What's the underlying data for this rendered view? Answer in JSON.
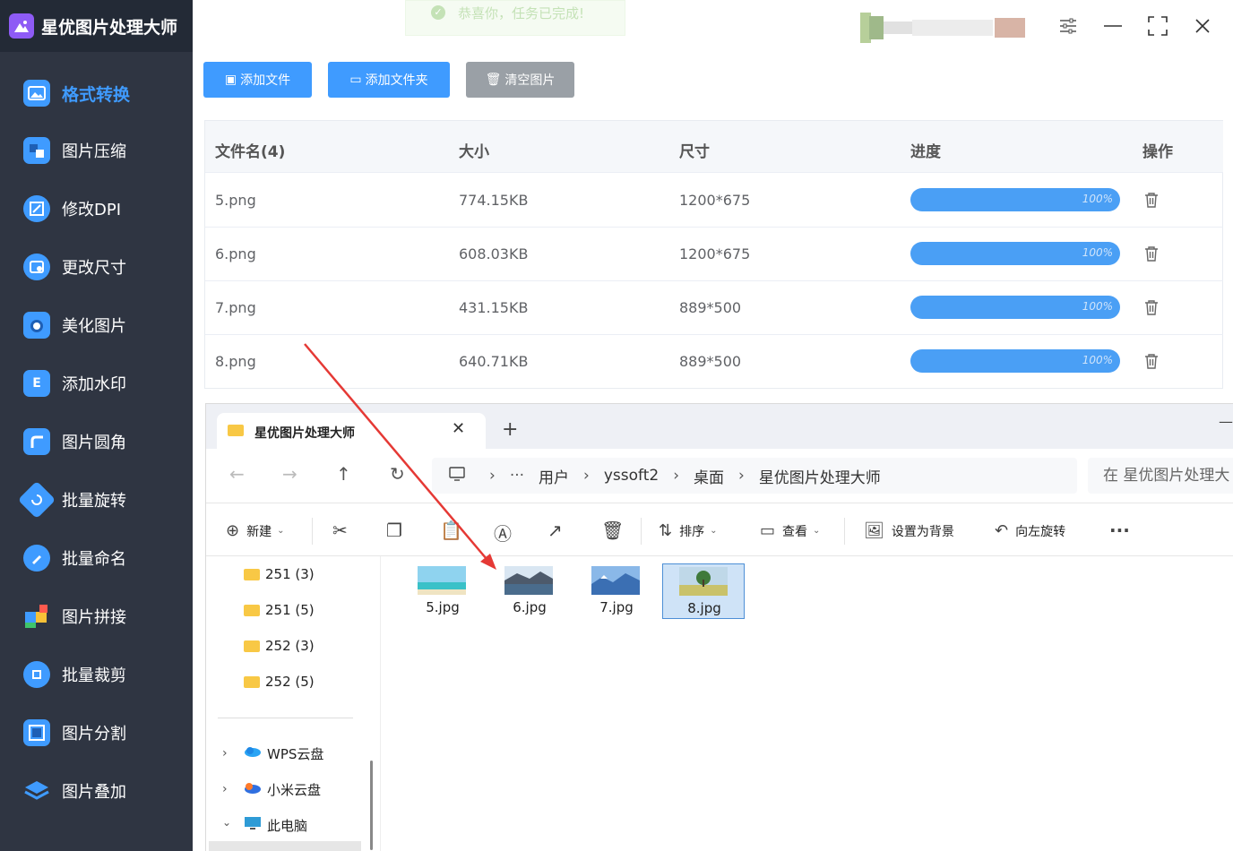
{
  "app": {
    "title": "星优图片处理大师"
  },
  "sidebar": {
    "items": [
      {
        "label": "格式转换",
        "icon": "image-convert-icon",
        "color": "#3f9bff",
        "active": true
      },
      {
        "label": "图片压缩",
        "icon": "compress-icon",
        "color": "#3f9bff"
      },
      {
        "label": "修改DPI",
        "icon": "dpi-icon",
        "color": "#3f9bff"
      },
      {
        "label": "更改尺寸",
        "icon": "resize-icon",
        "color": "#3f9bff"
      },
      {
        "label": "美化图片",
        "icon": "beautify-icon",
        "color": "#3f9bff"
      },
      {
        "label": "添加水印",
        "icon": "watermark-icon",
        "color": "#3f9bff"
      },
      {
        "label": "图片圆角",
        "icon": "rounded-corner-icon",
        "color": "#3f9bff"
      },
      {
        "label": "批量旋转",
        "icon": "rotate-icon",
        "color": "#3f9bff"
      },
      {
        "label": "批量命名",
        "icon": "rename-icon",
        "color": "#3f9bff"
      },
      {
        "label": "图片拼接",
        "icon": "puzzle-icon",
        "color": "#3f9bff"
      },
      {
        "label": "批量裁剪",
        "icon": "crop-icon",
        "color": "#3f9bff"
      },
      {
        "label": "图片分割",
        "icon": "split-icon",
        "color": "#3f9bff"
      },
      {
        "label": "图片叠加",
        "icon": "layers-icon",
        "color": "#3f9bff"
      }
    ]
  },
  "toast": {
    "text": "恭喜你，任务已完成!"
  },
  "toolbar": {
    "add_file": "添加文件",
    "add_folder": "添加文件夹",
    "clear": "清空图片"
  },
  "table": {
    "headers": {
      "name": "文件名(4)",
      "size": "大小",
      "dimensions": "尺寸",
      "progress": "进度",
      "action": "操作"
    },
    "rows": [
      {
        "name": "5.png",
        "size": "774.15KB",
        "dimensions": "1200*675",
        "progress": "100%"
      },
      {
        "name": "6.png",
        "size": "608.03KB",
        "dimensions": "1200*675",
        "progress": "100%"
      },
      {
        "name": "7.png",
        "size": "431.15KB",
        "dimensions": "889*500",
        "progress": "100%"
      },
      {
        "name": "8.png",
        "size": "640.71KB",
        "dimensions": "889*500",
        "progress": "100%"
      }
    ]
  },
  "explorer": {
    "tab_title": "星优图片处理大师",
    "breadcrumb": [
      "用户",
      "yssoft2",
      "桌面",
      "星优图片处理大师"
    ],
    "search_placeholder": "在 星优图片处理大",
    "commands": {
      "new": "新建",
      "sort": "排序",
      "view": "查看",
      "set_background": "设置为背景",
      "rotate_left": "向左旋转"
    },
    "tree": [
      {
        "label": "251 (3)",
        "type": "folder"
      },
      {
        "label": "251 (5)",
        "type": "folder"
      },
      {
        "label": "252 (3)",
        "type": "folder"
      },
      {
        "label": "252 (5)",
        "type": "folder"
      },
      {
        "label": "WPS云盘",
        "type": "cloud"
      },
      {
        "label": "小米云盘",
        "type": "cloud"
      },
      {
        "label": "此电脑",
        "type": "pc"
      }
    ],
    "files": [
      {
        "name": "5.jpg",
        "selected": false
      },
      {
        "name": "6.jpg",
        "selected": false
      },
      {
        "name": "7.jpg",
        "selected": false
      },
      {
        "name": "8.jpg",
        "selected": true
      }
    ]
  }
}
